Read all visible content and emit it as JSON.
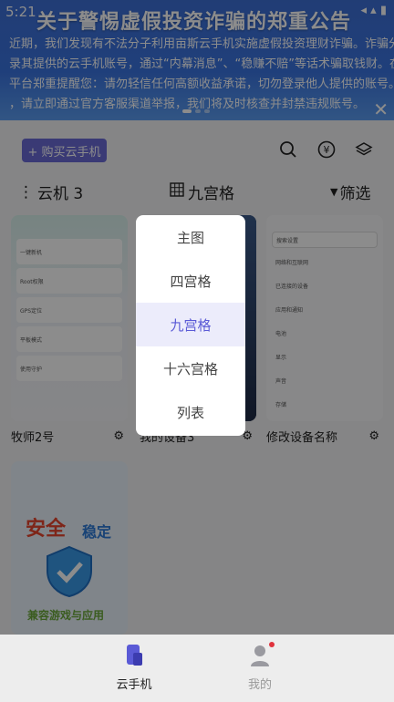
{
  "status_bar": {
    "time": "5:21",
    "icons": "◂ ▴ ▮"
  },
  "banner": {
    "title": "关于警惕虚假投资诈骗的郑重公告",
    "lines": [
      "近期，我们发现有不法分子利用亩斯云手机实施虚假投资理财诈骗。诈骗分子诱导",
      "录其提供的云手机账号，通过“内幕消息”、“稳赚不赔”等话术骗取钱财。在此",
      "平台郑重提醒您：请勿轻信任何高额收益承诺，切勿登录他人提供的账号。如遇可",
      "，请立即通过官方客服渠道举报，我们将及时核查并封禁违规账号。"
    ],
    "close_icon": "close-icon"
  },
  "toolbar": {
    "buy_label": "+ 购买云手机",
    "icons": [
      "search-icon",
      "yen-icon",
      "layers-icon"
    ]
  },
  "tabs": {
    "left_label": "云机 3",
    "mid_label": "九宫格",
    "right_label": "筛选"
  },
  "cards": [
    {
      "name": "牧师2号",
      "type": "settings-list"
    },
    {
      "name": "我的设备3",
      "type": "dark"
    },
    {
      "name": "修改设备名称",
      "type": "android-settings"
    }
  ],
  "card1_rows": [
    "一键新机",
    "Root权限",
    "GPS定位",
    "平板模式",
    "使用守护"
  ],
  "card3_rows": [
    "搜索设置",
    "网络和互联网",
    "已连接的设备",
    "应用和通知",
    "电池",
    "显示",
    "声音",
    "存储"
  ],
  "promo": {
    "headline_a": "安全",
    "headline_b": "稳定",
    "tagline": "兼容游戏与应用"
  },
  "view_menu": {
    "items": [
      "主图",
      "四宫格",
      "九宫格",
      "十六宫格",
      "列表"
    ],
    "selected": "九宫格"
  },
  "bottom_nav": {
    "items": [
      {
        "label": "云手机",
        "active": true
      },
      {
        "label": "我的",
        "active": false
      }
    ]
  },
  "colors": {
    "accent": "#5a5ad6",
    "banner": "#3d6fd6",
    "badge": "#e0323c"
  }
}
